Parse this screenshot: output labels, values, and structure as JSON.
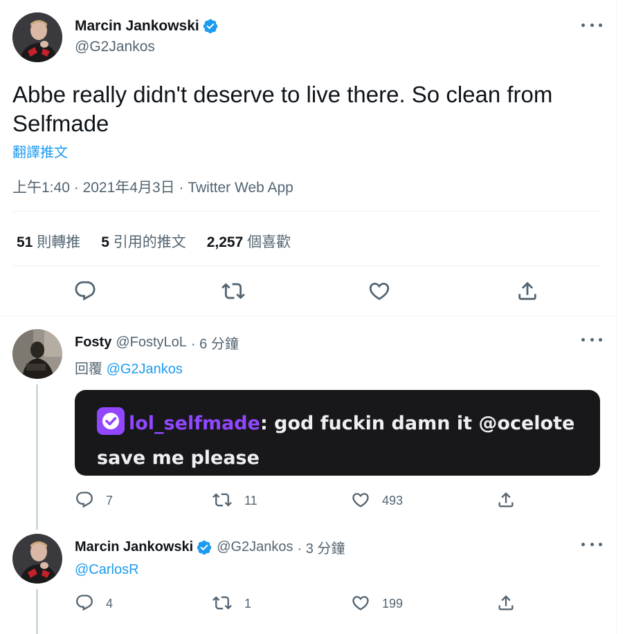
{
  "main_tweet": {
    "author_name": "Marcin Jankowski",
    "author_handle": "@G2Jankos",
    "text": "Abbe really didn't deserve to live there. So clean from Selfmade",
    "translate_label": "翻譯推文",
    "time": "上午1:40",
    "date": "2021年4月3日",
    "separator": "·",
    "source": "Twitter Web App",
    "stats": [
      {
        "value": "51",
        "label": "則轉推"
      },
      {
        "value": "5",
        "label": "引用的推文"
      },
      {
        "value": "2,257",
        "label": "個喜歡"
      }
    ]
  },
  "replies": [
    {
      "author_name": "Fosty",
      "author_handle": "@FostyLoL",
      "time": "· 6 分鐘",
      "reply_prefix": "回覆",
      "reply_to": "@G2Jankos",
      "media": {
        "chat_user": "lol_selfmade",
        "chat_message": ": god fuckin damn it @ocelote save me please"
      },
      "reply_count": "7",
      "retweet_count": "11",
      "like_count": "493"
    },
    {
      "author_name": "Marcin Jankowski",
      "author_handle": "@G2Jankos",
      "time": "· 3 分鐘",
      "mention": "@CarlosR",
      "reply_count": "4",
      "retweet_count": "1",
      "like_count": "199"
    }
  ],
  "colors": {
    "accent": "#1d9bf0",
    "muted_text": "#536471",
    "primary_text": "#0f1419",
    "twitch_purple": "#9147ff",
    "media_bg": "#18181b"
  },
  "icons": {
    "reply": "reply-icon",
    "retweet": "retweet-icon",
    "like": "heart-icon",
    "share": "share-icon",
    "more": "more-icon",
    "verified": "verified-badge-icon"
  }
}
